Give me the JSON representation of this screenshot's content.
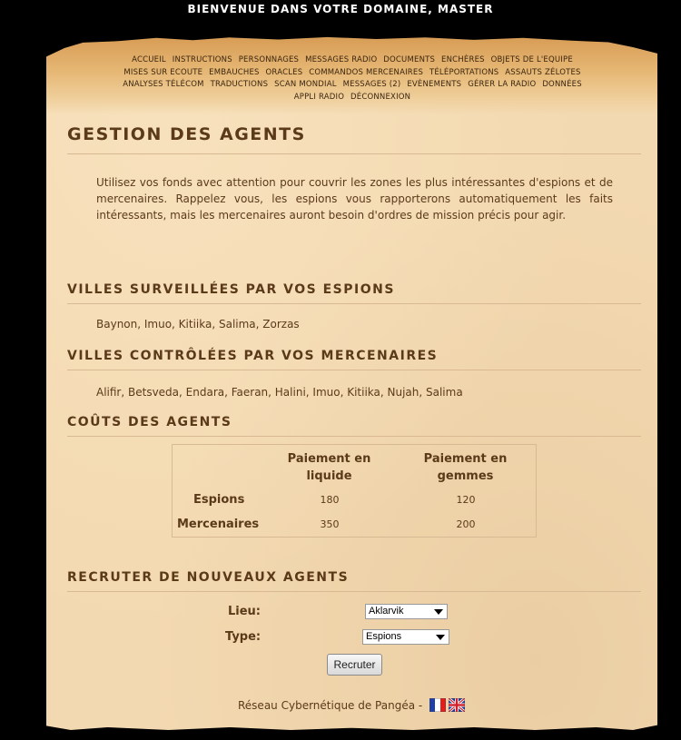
{
  "header": {
    "welcome": "BIENVENUE DANS VOTRE DOMAINE, MASTER"
  },
  "nav": {
    "line1": [
      "ACCUEIL",
      "INSTRUCTIONS",
      "PERSONNAGES",
      "MESSAGES RADIO",
      "DOCUMENTS",
      "ENCHÈRES",
      "OBJETS DE L'EQUIPE"
    ],
    "line2": [
      "MISES SUR ECOUTE",
      "EMBAUCHES",
      "ORACLES",
      "COMMANDOS MERCENAIRES",
      "TÉLÉPORTATIONS",
      "ASSAUTS ZÉLOTES"
    ],
    "line3": [
      "ANALYSES TÉLÉCOM",
      "TRADUCTIONS",
      "SCAN MONDIAL",
      "MESSAGES (2)",
      "EVÈNEMENTS",
      "GÉRER LA RADIO",
      "DONNÉES"
    ],
    "line4": [
      "APPLI RADIO",
      "DÉCONNEXION"
    ]
  },
  "page": {
    "title": "GESTION DES AGENTS",
    "intro": "Utilisez vos fonds avec attention pour couvrir les zones les plus intéressantes d'espions et de mercenaires. Rappelez vous, les espions vous rapporterons automatiquement les faits intéressants, mais les mercenaires auront besoin d'ordres de mission précis pour agir."
  },
  "spies": {
    "title": "VILLES SURVEILLÉES PAR VOS ESPIONS",
    "cities": "Baynon, Imuo, Kitiika, Salima, Zorzas"
  },
  "mercs": {
    "title": "VILLES CONTRÔLÉES PAR VOS MERCENAIRES",
    "cities": "Alifir, Betsveda, Endara, Faeran, Halini, Imuo, Kitiika, Nujah, Salima"
  },
  "costs": {
    "title": "COÛTS DES AGENTS",
    "col1_line1": "Paiement en",
    "col1_line2": "liquide",
    "col2_line1": "Paiement en",
    "col2_line2": "gemmes",
    "rows": [
      {
        "label": "Espions",
        "cash": "180",
        "gems": "120"
      },
      {
        "label": "Mercenaires",
        "cash": "350",
        "gems": "200"
      }
    ]
  },
  "recruit": {
    "title": "RECRUTER DE NOUVEAUX AGENTS",
    "lieu_label": "Lieu:",
    "lieu_value": "Aklarvik",
    "type_label": "Type:",
    "type_value": "Espions",
    "button": "Recruter"
  },
  "footer": {
    "text": "Réseau Cybernétique de Pangéa -"
  },
  "icons": {
    "flag_fr": "french-flag-icon",
    "flag_uk": "uk-flag-icon"
  }
}
